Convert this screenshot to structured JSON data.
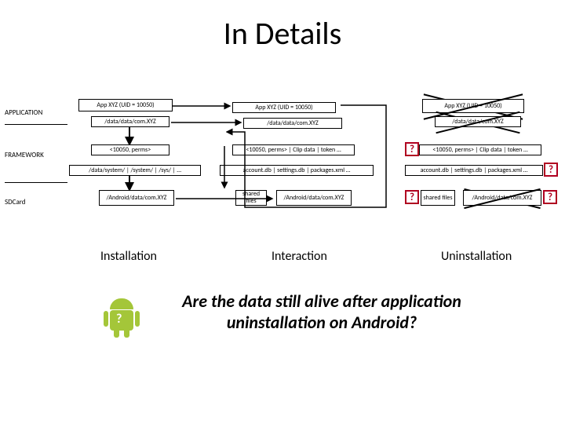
{
  "title": "In Details",
  "labels": {
    "application": "APPLICATION",
    "framework": "FRAMEWORK",
    "sdcard": "SDCard"
  },
  "columns": {
    "installation": "Installation",
    "interaction": "Interaction",
    "uninstallation": "Uninstallation"
  },
  "col1": {
    "app_header": "App XYZ  (UID = 10050)",
    "app_data": "/data/data/com.XYZ",
    "perms": "<10050, perms>",
    "syspaths": "/data/system/ | /system/ | /sys/ | …",
    "sdcard": "/Android/data/com.XYZ"
  },
  "col2": {
    "app_header": "App XYZ   (UID = 10050)",
    "app_data": "/data/data/com.XYZ",
    "perms": "<10050, perms> | Clip data | token …",
    "accounts": "account.db | settings.db | packages.xml …",
    "shared": "shared files",
    "sdcard": "/Android/data/com.XYZ"
  },
  "col3": {
    "app_header": "App XYZ   (UID = 10050)",
    "app_data": "/data/data/com.XYZ",
    "perms": "<10050, perms> | Clip data | token …",
    "accounts": "account.db | settings.db | packages.xml …",
    "shared": "shared files",
    "sdcard": "/Android/data/com.XYZ"
  },
  "question": "Are the data still alive after application uninstallation on Android?",
  "icons": {
    "q": "?"
  }
}
